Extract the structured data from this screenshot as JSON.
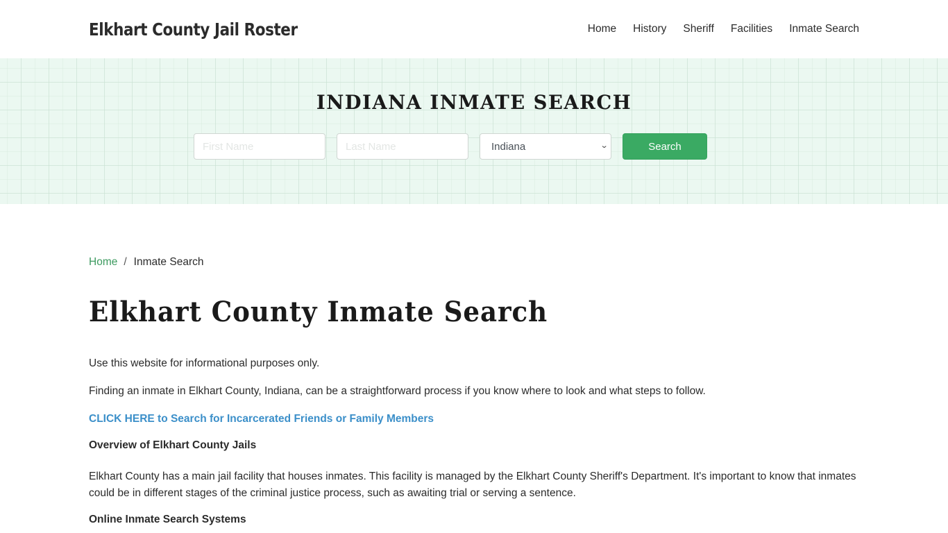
{
  "header": {
    "brand": "Elkhart County Jail Roster",
    "nav": [
      {
        "label": "Home"
      },
      {
        "label": "History"
      },
      {
        "label": "Sheriff"
      },
      {
        "label": "Facilities"
      },
      {
        "label": "Inmate Search"
      }
    ]
  },
  "hero": {
    "title": "INDIANA INMATE SEARCH",
    "first_name": {
      "value": "",
      "placeholder": "First Name"
    },
    "last_name": {
      "value": "",
      "placeholder": "Last Name"
    },
    "state_select": {
      "selected": "Indiana"
    },
    "search_label": "Search",
    "colors": {
      "accent": "#3aaa63",
      "background": "#ebf8f1"
    }
  },
  "breadcrumb": {
    "home": "Home",
    "separator": "/",
    "current": "Inmate Search"
  },
  "main": {
    "title": "Elkhart County Inmate Search",
    "intro": "Use this website for informational purposes only.",
    "lead": "Finding an inmate in Elkhart County, Indiana, can be a straightforward process if you know where to look and what steps to follow.",
    "cta": "CLICK HERE to Search for Incarcerated Friends or Family Members",
    "section1_heading": "Overview of Elkhart County Jails",
    "section1_body": "Elkhart County has a main jail facility that houses inmates. This facility is managed by the Elkhart County Sheriff's Department. It's important to know that inmates could be in different stages of the criminal justice process, such as awaiting trial or serving a sentence.",
    "section2_heading": "Online Inmate Search Systems",
    "colors": {
      "link": "#3b8fc9",
      "breadcrumb_link": "#3c9a5f"
    }
  }
}
